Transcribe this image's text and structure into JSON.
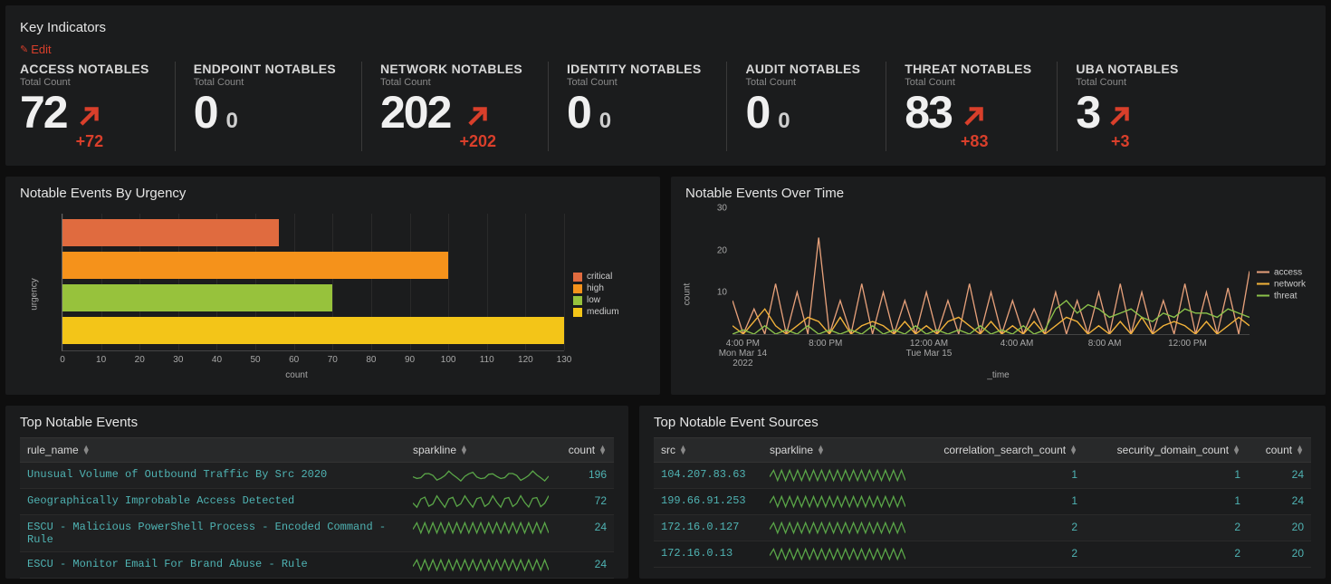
{
  "key_indicators": {
    "title": "Key Indicators",
    "edit_label": "Edit",
    "items": [
      {
        "title": "ACCESS NOTABLES",
        "sub": "Total Count",
        "value": "72",
        "delta": "+72"
      },
      {
        "title": "ENDPOINT NOTABLES",
        "sub": "Total Count",
        "value": "0",
        "delta": "0"
      },
      {
        "title": "NETWORK NOTABLES",
        "sub": "Total Count",
        "value": "202",
        "delta": "+202"
      },
      {
        "title": "IDENTITY NOTABLES",
        "sub": "Total Count",
        "value": "0",
        "delta": "0"
      },
      {
        "title": "AUDIT NOTABLES",
        "sub": "Total Count",
        "value": "0",
        "delta": "0"
      },
      {
        "title": "THREAT NOTABLES",
        "sub": "Total Count",
        "value": "83",
        "delta": "+83"
      },
      {
        "title": "UBA NOTABLES",
        "sub": "Total Count",
        "value": "3",
        "delta": "+3"
      }
    ]
  },
  "urgency_panel": {
    "title": "Notable Events By Urgency",
    "xlabel": "count",
    "ylabel": "urgency"
  },
  "time_panel": {
    "title": "Notable Events Over Time",
    "ylabel": "count",
    "xlabel": "_time"
  },
  "top_events": {
    "title": "Top Notable Events",
    "headers": {
      "rule_name": "rule_name",
      "sparkline": "sparkline",
      "count": "count"
    },
    "rows": [
      {
        "rule_name": "Unusual Volume of Outbound Traffic By Src 2020",
        "count": "196"
      },
      {
        "rule_name": "Geographically Improbable Access Detected",
        "count": "72"
      },
      {
        "rule_name": "ESCU - Malicious PowerShell Process - Encoded Command - Rule",
        "count": "24"
      },
      {
        "rule_name": "ESCU - Monitor Email For Brand Abuse - Rule",
        "count": "24"
      }
    ]
  },
  "top_sources": {
    "title": "Top Notable Event Sources",
    "headers": {
      "src": "src",
      "sparkline": "sparkline",
      "csc": "correlation_search_count",
      "sdc": "security_domain_count",
      "count": "count"
    },
    "rows": [
      {
        "src": "104.207.83.63",
        "csc": "1",
        "sdc": "1",
        "count": "24"
      },
      {
        "src": "199.66.91.253",
        "csc": "1",
        "sdc": "1",
        "count": "24"
      },
      {
        "src": "172.16.0.127",
        "csc": "2",
        "sdc": "2",
        "count": "20"
      },
      {
        "src": "172.16.0.13",
        "csc": "2",
        "sdc": "2",
        "count": "20"
      }
    ]
  },
  "colors": {
    "critical": "#e06b3f",
    "high": "#f5921b",
    "low": "#97c23c",
    "medium": "#f3c518",
    "access": "#e6a07a",
    "network": "#f3b33a",
    "threat": "#8bc24a",
    "delta": "#d93f2b",
    "link": "#4fb3b3"
  },
  "chart_data": [
    {
      "id": "urgency",
      "type": "bar",
      "orientation": "horizontal",
      "title": "Notable Events By Urgency",
      "xlabel": "count",
      "ylabel": "urgency",
      "categories": [
        "critical",
        "high",
        "low",
        "medium"
      ],
      "values": [
        56,
        100,
        70,
        130
      ],
      "xlim": [
        0,
        130
      ],
      "xticks": [
        0,
        10,
        20,
        30,
        40,
        50,
        60,
        70,
        80,
        90,
        100,
        110,
        120,
        130
      ],
      "colors": {
        "critical": "#e06b3f",
        "high": "#f5921b",
        "low": "#97c23c",
        "medium": "#f3c518"
      },
      "legend": [
        "critical",
        "high",
        "low",
        "medium"
      ]
    },
    {
      "id": "over_time",
      "type": "line",
      "title": "Notable Events Over Time",
      "xlabel": "_time",
      "ylabel": "count",
      "ylim": [
        0,
        30
      ],
      "yticks": [
        10,
        20,
        30
      ],
      "xticks": [
        {
          "pos": 0.02,
          "label": "4:00 PM\nMon Mar 14\n2022"
        },
        {
          "pos": 0.18,
          "label": "8:00 PM"
        },
        {
          "pos": 0.38,
          "label": "12:00 AM\nTue Mar 15"
        },
        {
          "pos": 0.55,
          "label": "4:00 AM"
        },
        {
          "pos": 0.72,
          "label": "8:00 AM"
        },
        {
          "pos": 0.88,
          "label": "12:00 PM"
        }
      ],
      "series": [
        {
          "name": "access",
          "color": "#e6a07a",
          "values": [
            8,
            0,
            6,
            0,
            12,
            0,
            10,
            0,
            23,
            0,
            8,
            0,
            12,
            0,
            10,
            0,
            8,
            0,
            10,
            0,
            8,
            0,
            12,
            0,
            10,
            0,
            8,
            0,
            6,
            0,
            10,
            0,
            8,
            0,
            10,
            0,
            12,
            0,
            10,
            0,
            8,
            0,
            12,
            0,
            10,
            0,
            11,
            0,
            15
          ]
        },
        {
          "name": "network",
          "color": "#f3b33a",
          "values": [
            2,
            0,
            3,
            6,
            2,
            0,
            2,
            4,
            3,
            0,
            4,
            0,
            2,
            3,
            2,
            0,
            3,
            0,
            2,
            0,
            3,
            4,
            2,
            0,
            3,
            0,
            2,
            0,
            3,
            0,
            2,
            4,
            3,
            0,
            2,
            0,
            3,
            0,
            4,
            0,
            2,
            3,
            2,
            0,
            3,
            0,
            2,
            4,
            2
          ]
        },
        {
          "name": "threat",
          "color": "#8bc24a",
          "values": [
            0,
            1,
            0,
            2,
            0,
            1,
            0,
            2,
            0,
            1,
            0,
            1,
            0,
            2,
            0,
            1,
            0,
            2,
            0,
            1,
            0,
            1,
            0,
            2,
            0,
            1,
            0,
            2,
            0,
            1,
            6,
            8,
            5,
            7,
            6,
            4,
            5,
            6,
            4,
            3,
            5,
            4,
            6,
            5,
            5,
            4,
            6,
            5,
            4
          ]
        }
      ],
      "legend": [
        "access",
        "network",
        "threat"
      ]
    }
  ]
}
